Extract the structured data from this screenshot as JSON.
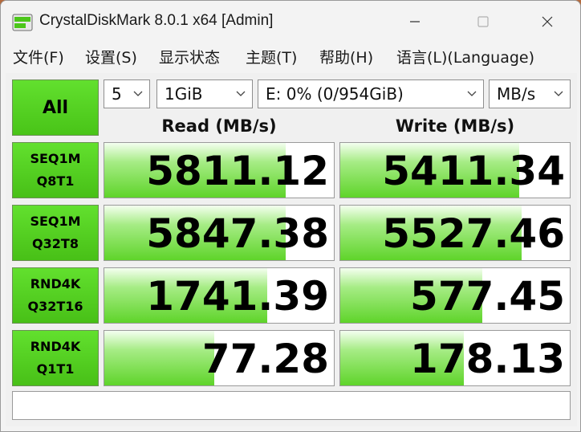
{
  "window": {
    "title": "CrystalDiskMark 8.0.1 x64 [Admin]"
  },
  "menu": [
    "文件(F)",
    "设置(S)",
    "显示状态",
    "主题(T)",
    "帮助(H)",
    "语言(L)(Language)"
  ],
  "controls": {
    "all_label": "All",
    "count": "5",
    "size": "1GiB",
    "drive": "E: 0% (0/954GiB)",
    "unit": "MB/s"
  },
  "headers": {
    "read": "Read (MB/s)",
    "write": "Write (MB/s)"
  },
  "tests": [
    {
      "line1": "SEQ1M",
      "line2": "Q8T1",
      "read": "5811.12",
      "write": "5411.34",
      "read_fill": 0.79,
      "write_fill": 0.78
    },
    {
      "line1": "SEQ1M",
      "line2": "Q32T8",
      "read": "5847.38",
      "write": "5527.46",
      "read_fill": 0.79,
      "write_fill": 0.79
    },
    {
      "line1": "RND4K",
      "line2": "Q32T16",
      "read": "1741.39",
      "write": "577.45",
      "read_fill": 0.71,
      "write_fill": 0.62
    },
    {
      "line1": "RND4K",
      "line2": "Q1T1",
      "read": "77.28",
      "write": "178.13",
      "read_fill": 0.48,
      "write_fill": 0.54
    }
  ],
  "comment": "",
  "colors": {
    "accent_green": "#4cc61a",
    "background": "#f0f0f0"
  }
}
